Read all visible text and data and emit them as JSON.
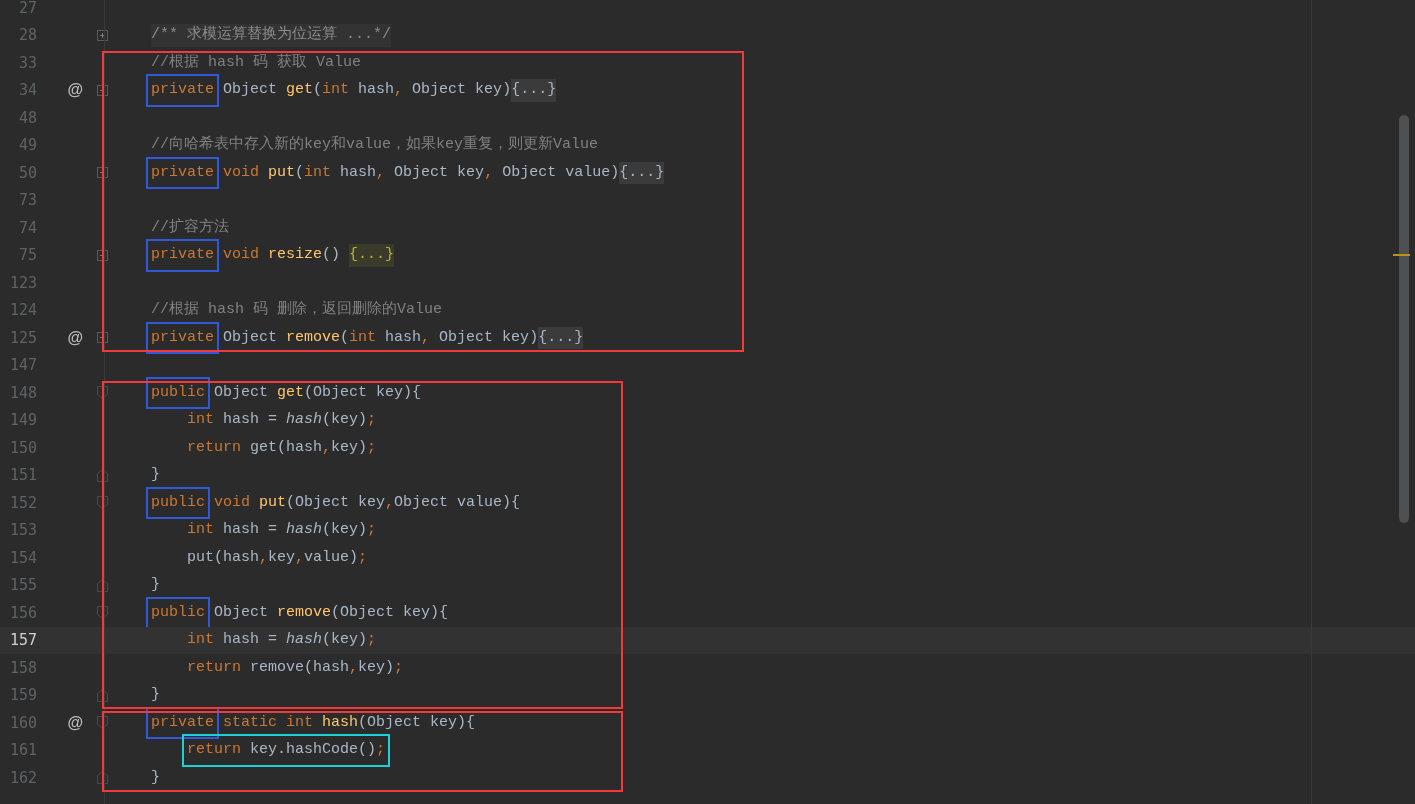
{
  "editor": {
    "lines": [
      {
        "number": "27",
        "current": false
      },
      {
        "number": "28",
        "current": false,
        "fold_marker": {
          "kind": "expand"
        },
        "tokens": [
          {
            "kind": "doc",
            "text": "/** 求模运算替换为位运算 ...*/"
          }
        ]
      },
      {
        "number": "33",
        "current": false,
        "frame": {
          "kind": "top",
          "color": "#f23a3a"
        },
        "tokens": [
          {
            "kind": "comment",
            "text": "//根据 hash 码 获取 Value"
          }
        ]
      },
      {
        "number": "34",
        "current": false,
        "gutter": "@",
        "fold_marker": {
          "kind": "collapse"
        },
        "tokens": [
          {
            "kind": "kw",
            "text": "private",
            "box": {
              "color": "#3058d8"
            }
          },
          {
            "kind": "plain",
            "text": " Object "
          },
          {
            "kind": "fn",
            "text": "get"
          },
          {
            "kind": "plain",
            "text": "("
          },
          {
            "kind": "kw",
            "text": "int"
          },
          {
            "kind": "plain",
            "text": " hash"
          },
          {
            "kind": "kw",
            "text": ","
          },
          {
            "kind": "plain",
            "text": " Object key)"
          },
          {
            "kind": "folded",
            "text": "{...}"
          }
        ]
      },
      {
        "number": "48",
        "current": false
      },
      {
        "number": "49",
        "current": false,
        "tokens": [
          {
            "kind": "comment",
            "text": "//向哈希表中存入新的key和value，如果key重复，则更新Value"
          }
        ]
      },
      {
        "number": "50",
        "current": false,
        "fold_marker": {
          "kind": "collapse"
        },
        "tokens": [
          {
            "kind": "kw",
            "text": "private",
            "box": {
              "color": "#3058d8"
            }
          },
          {
            "kind": "kw",
            "text": " void "
          },
          {
            "kind": "fn",
            "text": "put"
          },
          {
            "kind": "plain",
            "text": "("
          },
          {
            "kind": "kw",
            "text": "int"
          },
          {
            "kind": "plain",
            "text": " hash"
          },
          {
            "kind": "kw",
            "text": ","
          },
          {
            "kind": "plain",
            "text": " Object key"
          },
          {
            "kind": "kw",
            "text": ","
          },
          {
            "kind": "plain",
            "text": " Object value)"
          },
          {
            "kind": "folded",
            "text": "{...}"
          }
        ]
      },
      {
        "number": "73",
        "current": false
      },
      {
        "number": "74",
        "current": false,
        "tokens": [
          {
            "kind": "comment",
            "text": "//扩容方法"
          }
        ]
      },
      {
        "number": "75",
        "current": false,
        "fold_marker": {
          "kind": "collapse"
        },
        "tokens": [
          {
            "kind": "kw",
            "text": "private",
            "box": {
              "color": "#3058d8"
            }
          },
          {
            "kind": "kw",
            "text": " void "
          },
          {
            "kind": "fn",
            "text": "resize"
          },
          {
            "kind": "plain",
            "text": "() "
          },
          {
            "kind": "folded-match",
            "text": "{...}"
          }
        ]
      },
      {
        "number": "123",
        "current": false
      },
      {
        "number": "124",
        "current": false,
        "tokens": [
          {
            "kind": "comment",
            "text": "//根据 hash 码 删除，返回删除的Value"
          }
        ]
      },
      {
        "number": "125",
        "current": false,
        "gutter": "@",
        "fold_marker": {
          "kind": "collapse"
        },
        "frame": {
          "kind": "bottom"
        },
        "tokens": [
          {
            "kind": "kw",
            "text": "private",
            "box": {
              "color": "#3058d8"
            }
          },
          {
            "kind": "plain",
            "text": " Object "
          },
          {
            "kind": "fn",
            "text": "remove"
          },
          {
            "kind": "plain",
            "text": "("
          },
          {
            "kind": "kw",
            "text": "int"
          },
          {
            "kind": "plain",
            "text": " hash"
          },
          {
            "kind": "kw",
            "text": ","
          },
          {
            "kind": "plain",
            "text": " Object key)"
          },
          {
            "kind": "folded",
            "text": "{...}"
          }
        ]
      },
      {
        "number": "147",
        "current": false
      },
      {
        "number": "148",
        "current": false,
        "fold_marker": {
          "kind": "block-start"
        },
        "frame": {
          "kind": "top",
          "color": "#f23a3a"
        },
        "tokens": [
          {
            "kind": "kw",
            "text": "public",
            "box": {
              "color": "#3058d8"
            }
          },
          {
            "kind": "plain",
            "text": " Object "
          },
          {
            "kind": "fn",
            "text": "get"
          },
          {
            "kind": "plain",
            "text": "(Object key){"
          }
        ]
      },
      {
        "number": "149",
        "current": false,
        "tokens": [
          {
            "kind": "kw",
            "text": "    int"
          },
          {
            "kind": "plain",
            "text": " hash = "
          },
          {
            "kind": "italic",
            "text": "hash"
          },
          {
            "kind": "plain",
            "text": "(key)"
          },
          {
            "kind": "kw",
            "text": ";"
          }
        ]
      },
      {
        "number": "150",
        "current": false,
        "tokens": [
          {
            "kind": "kw",
            "text": "    return"
          },
          {
            "kind": "plain",
            "text": " get(hash"
          },
          {
            "kind": "kw",
            "text": ","
          },
          {
            "kind": "plain",
            "text": "key)"
          },
          {
            "kind": "kw",
            "text": ";"
          }
        ]
      },
      {
        "number": "151",
        "current": false,
        "fold_marker": {
          "kind": "block-end"
        },
        "tokens": [
          {
            "kind": "plain",
            "text": "}"
          }
        ]
      },
      {
        "number": "152",
        "current": false,
        "fold_marker": {
          "kind": "block-start"
        },
        "tokens": [
          {
            "kind": "kw",
            "text": "public",
            "box": {
              "color": "#3058d8"
            }
          },
          {
            "kind": "kw",
            "text": " void "
          },
          {
            "kind": "fn",
            "text": "put"
          },
          {
            "kind": "plain",
            "text": "(Object key"
          },
          {
            "kind": "kw",
            "text": ","
          },
          {
            "kind": "plain",
            "text": "Object value){"
          }
        ]
      },
      {
        "number": "153",
        "current": false,
        "tokens": [
          {
            "kind": "kw",
            "text": "    int"
          },
          {
            "kind": "plain",
            "text": " hash = "
          },
          {
            "kind": "italic",
            "text": "hash"
          },
          {
            "kind": "plain",
            "text": "(key)"
          },
          {
            "kind": "kw",
            "text": ";"
          }
        ]
      },
      {
        "number": "154",
        "current": false,
        "tokens": [
          {
            "kind": "plain",
            "text": "    put(hash"
          },
          {
            "kind": "kw",
            "text": ","
          },
          {
            "kind": "plain",
            "text": "key"
          },
          {
            "kind": "kw",
            "text": ","
          },
          {
            "kind": "plain",
            "text": "value)"
          },
          {
            "kind": "kw",
            "text": ";"
          }
        ]
      },
      {
        "number": "155",
        "current": false,
        "fold_marker": {
          "kind": "block-end"
        },
        "tokens": [
          {
            "kind": "plain",
            "text": "}"
          }
        ]
      },
      {
        "number": "156",
        "current": false,
        "fold_marker": {
          "kind": "block-start"
        },
        "tokens": [
          {
            "kind": "kw",
            "text": "public",
            "box": {
              "color": "#3058d8"
            }
          },
          {
            "kind": "plain",
            "text": " Object "
          },
          {
            "kind": "fn",
            "text": "remove"
          },
          {
            "kind": "plain",
            "text": "(Object key){"
          }
        ]
      },
      {
        "number": "157",
        "current": true,
        "tokens": [
          {
            "kind": "kw",
            "text": "    int"
          },
          {
            "kind": "plain",
            "text": " hash = "
          },
          {
            "kind": "italic",
            "text": "hash"
          },
          {
            "kind": "plain",
            "text": "(key)"
          },
          {
            "kind": "kw",
            "text": ";"
          }
        ]
      },
      {
        "number": "158",
        "current": false,
        "tokens": [
          {
            "kind": "kw",
            "text": "    return"
          },
          {
            "kind": "plain",
            "text": " remove(hash"
          },
          {
            "kind": "kw",
            "text": ","
          },
          {
            "kind": "plain",
            "text": "key)"
          },
          {
            "kind": "kw",
            "text": ";"
          }
        ]
      },
      {
        "number": "159",
        "current": false,
        "fold_marker": {
          "kind": "block-end"
        },
        "frame": {
          "kind": "bottom"
        },
        "tokens": [
          {
            "kind": "plain",
            "text": "}"
          }
        ]
      },
      {
        "number": "160",
        "current": false,
        "gutter": "@",
        "fold_marker": {
          "kind": "block-start"
        },
        "frame": {
          "kind": "top",
          "color": "#f23a3a"
        },
        "tokens": [
          {
            "kind": "kw",
            "text": "private",
            "box": {
              "color": "#3058d8"
            }
          },
          {
            "kind": "kw",
            "text": " static int "
          },
          {
            "kind": "fn",
            "text": "hash"
          },
          {
            "kind": "plain",
            "text": "(Object key){"
          }
        ]
      },
      {
        "number": "161",
        "current": false,
        "tokens": [
          {
            "kind": "kw",
            "text": "    return",
            "box": {
              "color": "#1ecfd6"
            }
          },
          {
            "kind": "plain",
            "text": " key.hashCode()",
            "box": {
              "color": "#1ecfd6"
            }
          },
          {
            "kind": "kw",
            "text": ";",
            "box": {
              "color": "#1ecfd6"
            }
          }
        ]
      },
      {
        "number": "162",
        "current": false,
        "fold_marker": {
          "kind": "block-end"
        },
        "frame": {
          "kind": "bottom"
        },
        "tokens": [
          {
            "kind": "plain",
            "text": "}"
          }
        ]
      }
    ]
  }
}
